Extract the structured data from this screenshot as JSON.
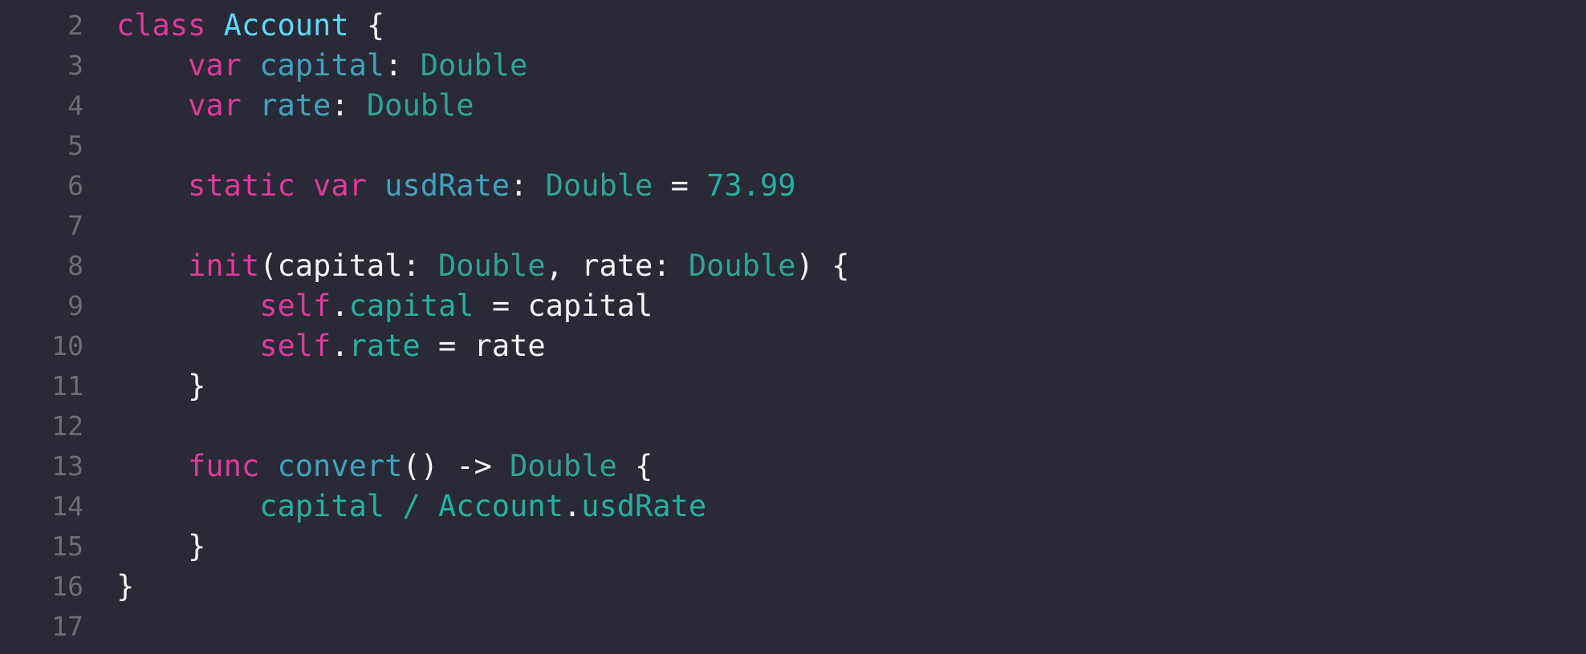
{
  "editor": {
    "lines": [
      {
        "number": "2",
        "tokens": [
          {
            "t": "class",
            "c": "kw"
          },
          {
            "t": " ",
            "c": "plain"
          },
          {
            "t": "Account",
            "c": "decl"
          },
          {
            "t": " {",
            "c": "plain"
          }
        ]
      },
      {
        "number": "3",
        "tokens": [
          {
            "t": "    ",
            "c": "plain"
          },
          {
            "t": "var",
            "c": "kw"
          },
          {
            "t": " ",
            "c": "plain"
          },
          {
            "t": "capital",
            "c": "prop"
          },
          {
            "t": ": ",
            "c": "plain"
          },
          {
            "t": "Double",
            "c": "type"
          }
        ]
      },
      {
        "number": "4",
        "tokens": [
          {
            "t": "    ",
            "c": "plain"
          },
          {
            "t": "var",
            "c": "kw"
          },
          {
            "t": " ",
            "c": "plain"
          },
          {
            "t": "rate",
            "c": "prop"
          },
          {
            "t": ": ",
            "c": "plain"
          },
          {
            "t": "Double",
            "c": "type"
          }
        ]
      },
      {
        "number": "5",
        "tokens": []
      },
      {
        "number": "6",
        "tokens": [
          {
            "t": "    ",
            "c": "plain"
          },
          {
            "t": "static",
            "c": "kw"
          },
          {
            "t": " ",
            "c": "plain"
          },
          {
            "t": "var",
            "c": "kw"
          },
          {
            "t": " ",
            "c": "plain"
          },
          {
            "t": "usdRate",
            "c": "prop"
          },
          {
            "t": ": ",
            "c": "plain"
          },
          {
            "t": "Double",
            "c": "type"
          },
          {
            "t": " = ",
            "c": "plain"
          },
          {
            "t": "73.99",
            "c": "num"
          }
        ]
      },
      {
        "number": "7",
        "tokens": []
      },
      {
        "number": "8",
        "tokens": [
          {
            "t": "    ",
            "c": "plain"
          },
          {
            "t": "init",
            "c": "kw"
          },
          {
            "t": "(capital: ",
            "c": "plain"
          },
          {
            "t": "Double",
            "c": "type"
          },
          {
            "t": ", rate: ",
            "c": "plain"
          },
          {
            "t": "Double",
            "c": "type"
          },
          {
            "t": ") {",
            "c": "plain"
          }
        ]
      },
      {
        "number": "9",
        "tokens": [
          {
            "t": "        ",
            "c": "plain"
          },
          {
            "t": "self",
            "c": "kw"
          },
          {
            "t": ".",
            "c": "plain"
          },
          {
            "t": "capital",
            "c": "member"
          },
          {
            "t": " = capital",
            "c": "plain"
          }
        ]
      },
      {
        "number": "10",
        "tokens": [
          {
            "t": "        ",
            "c": "plain"
          },
          {
            "t": "self",
            "c": "kw"
          },
          {
            "t": ".",
            "c": "plain"
          },
          {
            "t": "rate",
            "c": "member"
          },
          {
            "t": " = rate",
            "c": "plain"
          }
        ]
      },
      {
        "number": "11",
        "tokens": [
          {
            "t": "    }",
            "c": "plain"
          }
        ]
      },
      {
        "number": "12",
        "tokens": []
      },
      {
        "number": "13",
        "tokens": [
          {
            "t": "    ",
            "c": "plain"
          },
          {
            "t": "func",
            "c": "kw"
          },
          {
            "t": " ",
            "c": "plain"
          },
          {
            "t": "convert",
            "c": "prop"
          },
          {
            "t": "() -> ",
            "c": "plain"
          },
          {
            "t": "Double",
            "c": "type"
          },
          {
            "t": " {",
            "c": "plain"
          }
        ]
      },
      {
        "number": "14",
        "tokens": [
          {
            "t": "        ",
            "c": "plain"
          },
          {
            "t": "capital / Account",
            "c": "member"
          },
          {
            "t": ".",
            "c": "plain"
          },
          {
            "t": "usdRate",
            "c": "member"
          }
        ]
      },
      {
        "number": "15",
        "tokens": [
          {
            "t": "    }",
            "c": "plain"
          }
        ]
      },
      {
        "number": "16",
        "tokens": [
          {
            "t": "}",
            "c": "plain"
          }
        ]
      },
      {
        "number": "17",
        "tokens": []
      }
    ]
  },
  "colors": {
    "background": "#292a35",
    "line_number": "#6c6d75",
    "keyword": "#e0399e",
    "declaration": "#5dd8ff",
    "property": "#41a1c0",
    "type": "#2fa398",
    "number": "#1fb2a5",
    "member": "#25b0a3",
    "plain": "#f5f5f5"
  }
}
